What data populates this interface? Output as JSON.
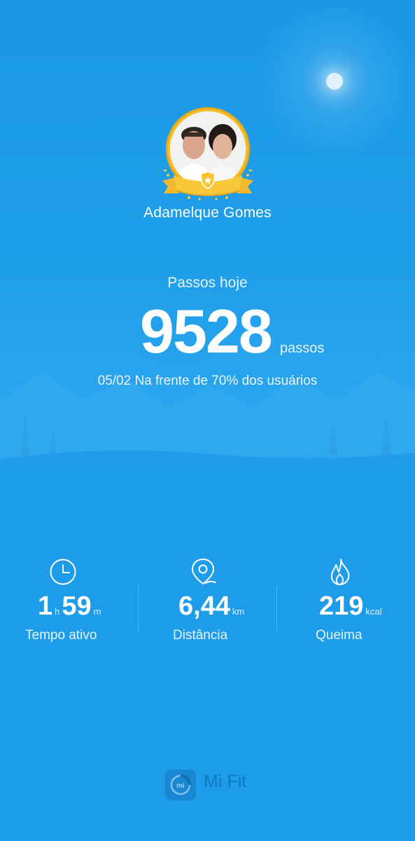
{
  "profile": {
    "user_name": "Adamelque Gomes"
  },
  "steps": {
    "label": "Passos hoje",
    "count": "9528",
    "unit": "passos",
    "rank_text": "05/02 Na frente de 70% dos usuários"
  },
  "stats": [
    {
      "icon": "clock-icon",
      "value_hours": "1",
      "unit_hours": "h",
      "value_minutes": "59",
      "unit_minutes": "m",
      "label": "Tempo ativo"
    },
    {
      "icon": "location-pin-icon",
      "value": "6,44",
      "unit": "km",
      "label": "Distância"
    },
    {
      "icon": "flame-icon",
      "value": "219",
      "unit": "kcal",
      "label": "Queima"
    }
  ],
  "footer": {
    "app_name": "Mi Fit"
  },
  "colors": {
    "background": "#1c9ce9",
    "text": "#ffffff",
    "badge_gold": "#f5c232"
  }
}
